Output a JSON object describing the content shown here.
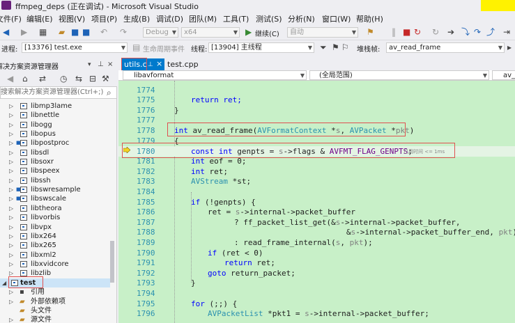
{
  "window": {
    "title": "ffmpeg_deps (正在调试) - Microsoft Visual Studio"
  },
  "menu": [
    "文件(F)",
    "编辑(E)",
    "视图(V)",
    "项目(P)",
    "生成(B)",
    "调试(D)",
    "团队(M)",
    "工具(T)",
    "测试(S)",
    "分析(N)",
    "窗口(W)",
    "帮助(H)"
  ],
  "toolbar": {
    "config": "Debug",
    "platform": "x64",
    "continue_label": "继续(C)",
    "auto_label": "自动"
  },
  "debugbar": {
    "process_label": "进程:",
    "process_value": "[13376] test.exe",
    "lifecycle_label": "生命周期事件",
    "thread_label": "线程:",
    "thread_value": "[13904] 主线程",
    "stack_label": "堆栈帧:",
    "stack_value": "av_read_frame"
  },
  "solution": {
    "header": "解决方案资源管理器",
    "search_placeholder": "搜索解决方案资源管理器(Ctrl+;)",
    "projects": [
      "libmp3lame",
      "libnettle",
      "libogg",
      "libopus",
      "libpostproc",
      "libsdl",
      "libsoxr",
      "libspeex",
      "libssh",
      "libswresample",
      "libswscale",
      "libtheora",
      "libvorbis",
      "libvpx",
      "libx264",
      "libx265",
      "libxml2",
      "libxvidcore",
      "libzlib",
      "test"
    ],
    "children": [
      "引用",
      "外部依赖项",
      "头文件",
      "源文件"
    ]
  },
  "tabs": {
    "active": "utils.c",
    "inactive": "test.cpp"
  },
  "nav": {
    "scope": "libavformat",
    "range": "(全局范围)",
    "member": "av_r"
  },
  "code": {
    "lines": [
      "1774",
      "1775",
      "1776",
      "1777",
      "1778",
      "1779",
      "1780",
      "1781",
      "1782",
      "1783",
      "1784",
      "1785",
      "1786",
      "1787",
      "1788",
      "1789",
      "1790",
      "1791",
      "1792",
      "1793",
      "1794",
      "1795",
      "1796"
    ],
    "l1775": "return ret;",
    "l1776": "}",
    "l1778_kw": "int",
    "l1778_fn": " av_read_frame(",
    "l1778_t1": "AVFormatContext",
    "l1778_a1": " *",
    "l1778_p1": "s",
    "l1778_c": ", ",
    "l1778_t2": "AVPacket",
    "l1778_a2": " *",
    "l1778_p2": "pkt",
    "l1778_end": ")",
    "l1779": "{",
    "l1780_kw": "const int",
    "l1780_a": " genpts = ",
    "l1780_s": "s",
    "l1780_b": "->flags & ",
    "l1780_m": "AVFMT_FLAG_GENPTS",
    "l1780_e": ";",
    "l1780_hint": "已用时间 <= 1ms",
    "l1781_kw": "int",
    "l1781": " eof = 0;",
    "l1782_kw": "int",
    "l1782": " ret;",
    "l1783_t": "AVStream",
    "l1783": " *st;",
    "l1785_kw": "if",
    "l1785": " (!genpts) {",
    "l1786_a": "ret = ",
    "l1786_s": "s",
    "l1786_b": "->internal->packet_buffer",
    "l1787_a": "? ff_packet_list_get(&",
    "l1787_s": "s",
    "l1787_b": "->internal->packet_buffer,",
    "l1788_a": "&",
    "l1788_s": "s",
    "l1788_b": "->internal->packet_buffer_end, ",
    "l1788_p": "pkt",
    "l1788_e": ")",
    "l1789_a": ": read_frame_internal(",
    "l1789_s": "s",
    "l1789_c": ", ",
    "l1789_p": "pkt",
    "l1789_e": ");",
    "l1790_kw": "if",
    "l1790": " (ret < 0)",
    "l1791_kw": "return",
    "l1791": " ret;",
    "l1792_kw": "goto",
    "l1792": " return_packet;",
    "l1793": "}",
    "l1795_kw": "for",
    "l1795": " (;;) {",
    "l1796_t": "AVPacketList",
    "l1796_a": " *pkt1 = ",
    "l1796_s": "s",
    "l1796_b": "->internal->packet_buffer;"
  }
}
